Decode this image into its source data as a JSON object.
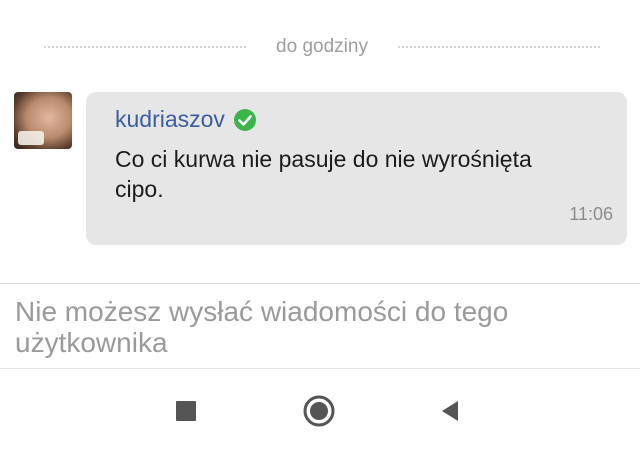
{
  "chat": {
    "date_divider": "do godziny",
    "message": {
      "sender": "kudriaszov",
      "text": "Co ci kurwa nie pasuje do nie wyrośnięta cipo.",
      "time": "11:06",
      "verified_icon": "check-circle-icon"
    }
  },
  "footer": {
    "blocked_notice": "Nie możesz wysłać wiadomości do tego użytkownika"
  },
  "navbar": {
    "icons": [
      "square-recents-icon",
      "circle-home-icon",
      "triangle-back-icon"
    ]
  },
  "colors": {
    "sender": "#3a5da0",
    "verified": "#3bb54a",
    "bubble": "#e6e6e6",
    "nav_icon": "#555555"
  }
}
